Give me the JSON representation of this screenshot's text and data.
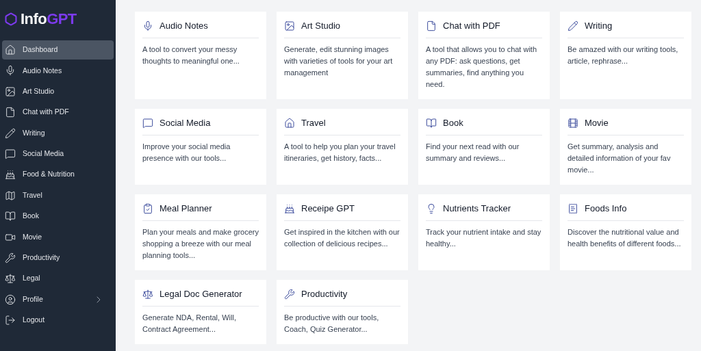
{
  "logo": {
    "text": "Info",
    "accent": "GPT"
  },
  "sidebar": {
    "items": [
      {
        "label": "Dashboard",
        "selected": true,
        "kind": "link"
      },
      {
        "label": "Audio Notes",
        "selected": false,
        "kind": "link"
      },
      {
        "label": "Art Studio",
        "selected": false,
        "kind": "link"
      },
      {
        "label": "Chat with PDF",
        "selected": false,
        "kind": "link"
      },
      {
        "label": "Writing",
        "selected": false,
        "kind": "link"
      },
      {
        "label": "Social Media",
        "selected": false,
        "kind": "link"
      },
      {
        "label": "Food & Nutrition",
        "selected": false,
        "kind": "link"
      },
      {
        "label": "Travel",
        "selected": false,
        "kind": "link"
      },
      {
        "label": "Book",
        "selected": false,
        "kind": "link"
      },
      {
        "label": "Movie",
        "selected": false,
        "kind": "link"
      },
      {
        "label": "Productivity",
        "selected": false,
        "kind": "link"
      },
      {
        "label": "Legal",
        "selected": false,
        "kind": "link"
      },
      {
        "label": "Profile",
        "selected": false,
        "kind": "submenu"
      },
      {
        "label": "Logout",
        "selected": false,
        "kind": "link"
      }
    ]
  },
  "cards": [
    {
      "title": "Audio Notes",
      "description": "A tool to convert your messy thoughts to meaningful one..."
    },
    {
      "title": "Art Studio",
      "description": "Generate, edit stunning images with varieties of tools for your art management"
    },
    {
      "title": "Chat with PDF",
      "description": "A tool that allows you to chat with any PDF: ask questions, get summaries, find anything you need."
    },
    {
      "title": "Writing",
      "description": "Be amazed with our writing tools, article, rephrase..."
    },
    {
      "title": "Social Media",
      "description": "Improve your social media presence with our tools..."
    },
    {
      "title": "Travel",
      "description": "A tool to help you plan your travel itineraries, get history, facts..."
    },
    {
      "title": "Book",
      "description": "Find your next read with our summary and reviews..."
    },
    {
      "title": "Movie",
      "description": "Get summary, analysis and detailed information of your fav movie..."
    },
    {
      "title": "Meal Planner",
      "description": "Plan your meals and make grocery shopping a breeze with our meal planning tools..."
    },
    {
      "title": "Receipe GPT",
      "description": "Get inspired in the kitchen with our collection of delicious recipes..."
    },
    {
      "title": "Nutrients Tracker",
      "description": "Track your nutrient intake and stay healthy..."
    },
    {
      "title": "Foods Info",
      "description": "Discover the nutritional value and health benefits of different foods..."
    },
    {
      "title": "Legal Doc Generator",
      "description": "Generate NDA, Rental, Will, Contract Agreement..."
    },
    {
      "title": "Productivity",
      "description": "Be productive with our tools, Coach, Quiz Generator..."
    }
  ]
}
